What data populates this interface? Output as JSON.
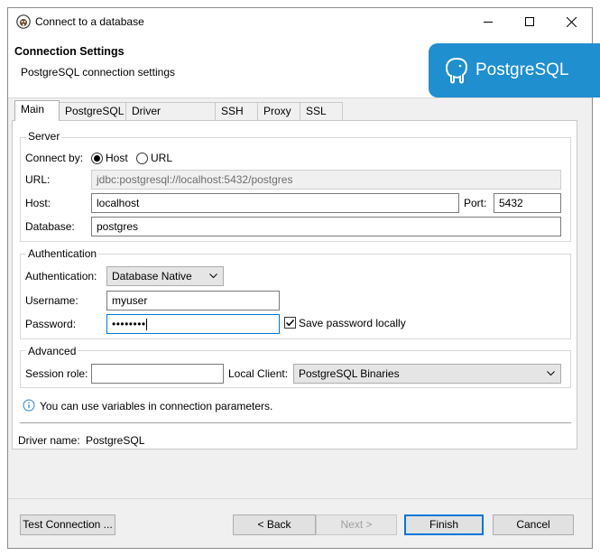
{
  "window": {
    "title": "Connect to a database"
  },
  "header": {
    "title": "Connection Settings",
    "subtitle": "PostgreSQL connection settings",
    "logo_text": "PostgreSQL"
  },
  "tabs": [
    "Main",
    "PostgreSQL",
    "Driver properties",
    "SSH",
    "Proxy",
    "SSL"
  ],
  "server": {
    "legend": "Server",
    "connect_by_label": "Connect by:",
    "host_option": "Host",
    "url_option": "URL",
    "connect_by_selected": "Host",
    "url_label": "URL:",
    "url_value": "jdbc:postgresql://localhost:5432/postgres",
    "host_label": "Host:",
    "host_value": "localhost",
    "port_label": "Port:",
    "port_value": "5432",
    "database_label": "Database:",
    "database_value": "postgres"
  },
  "auth": {
    "legend": "Authentication",
    "auth_label": "Authentication:",
    "auth_value": "Database Native",
    "username_label": "Username:",
    "username_value": "myuser",
    "password_label": "Password:",
    "password_mask": "••••••••",
    "save_password_label": "Save password locally",
    "save_password_checked": true
  },
  "advanced": {
    "legend": "Advanced",
    "session_role_label": "Session role:",
    "session_role_value": "",
    "local_client_label": "Local Client:",
    "local_client_value": "PostgreSQL Binaries"
  },
  "info_text": "You can use variables in connection parameters.",
  "driver": {
    "label": "Driver name:",
    "value": "PostgreSQL"
  },
  "buttons": {
    "test": "Test Connection ...",
    "back": "< Back",
    "next": "Next >",
    "finish": "Finish",
    "cancel": "Cancel"
  },
  "colors": {
    "accent": "#0078d7",
    "logo_bg": "#1f8fcf"
  }
}
